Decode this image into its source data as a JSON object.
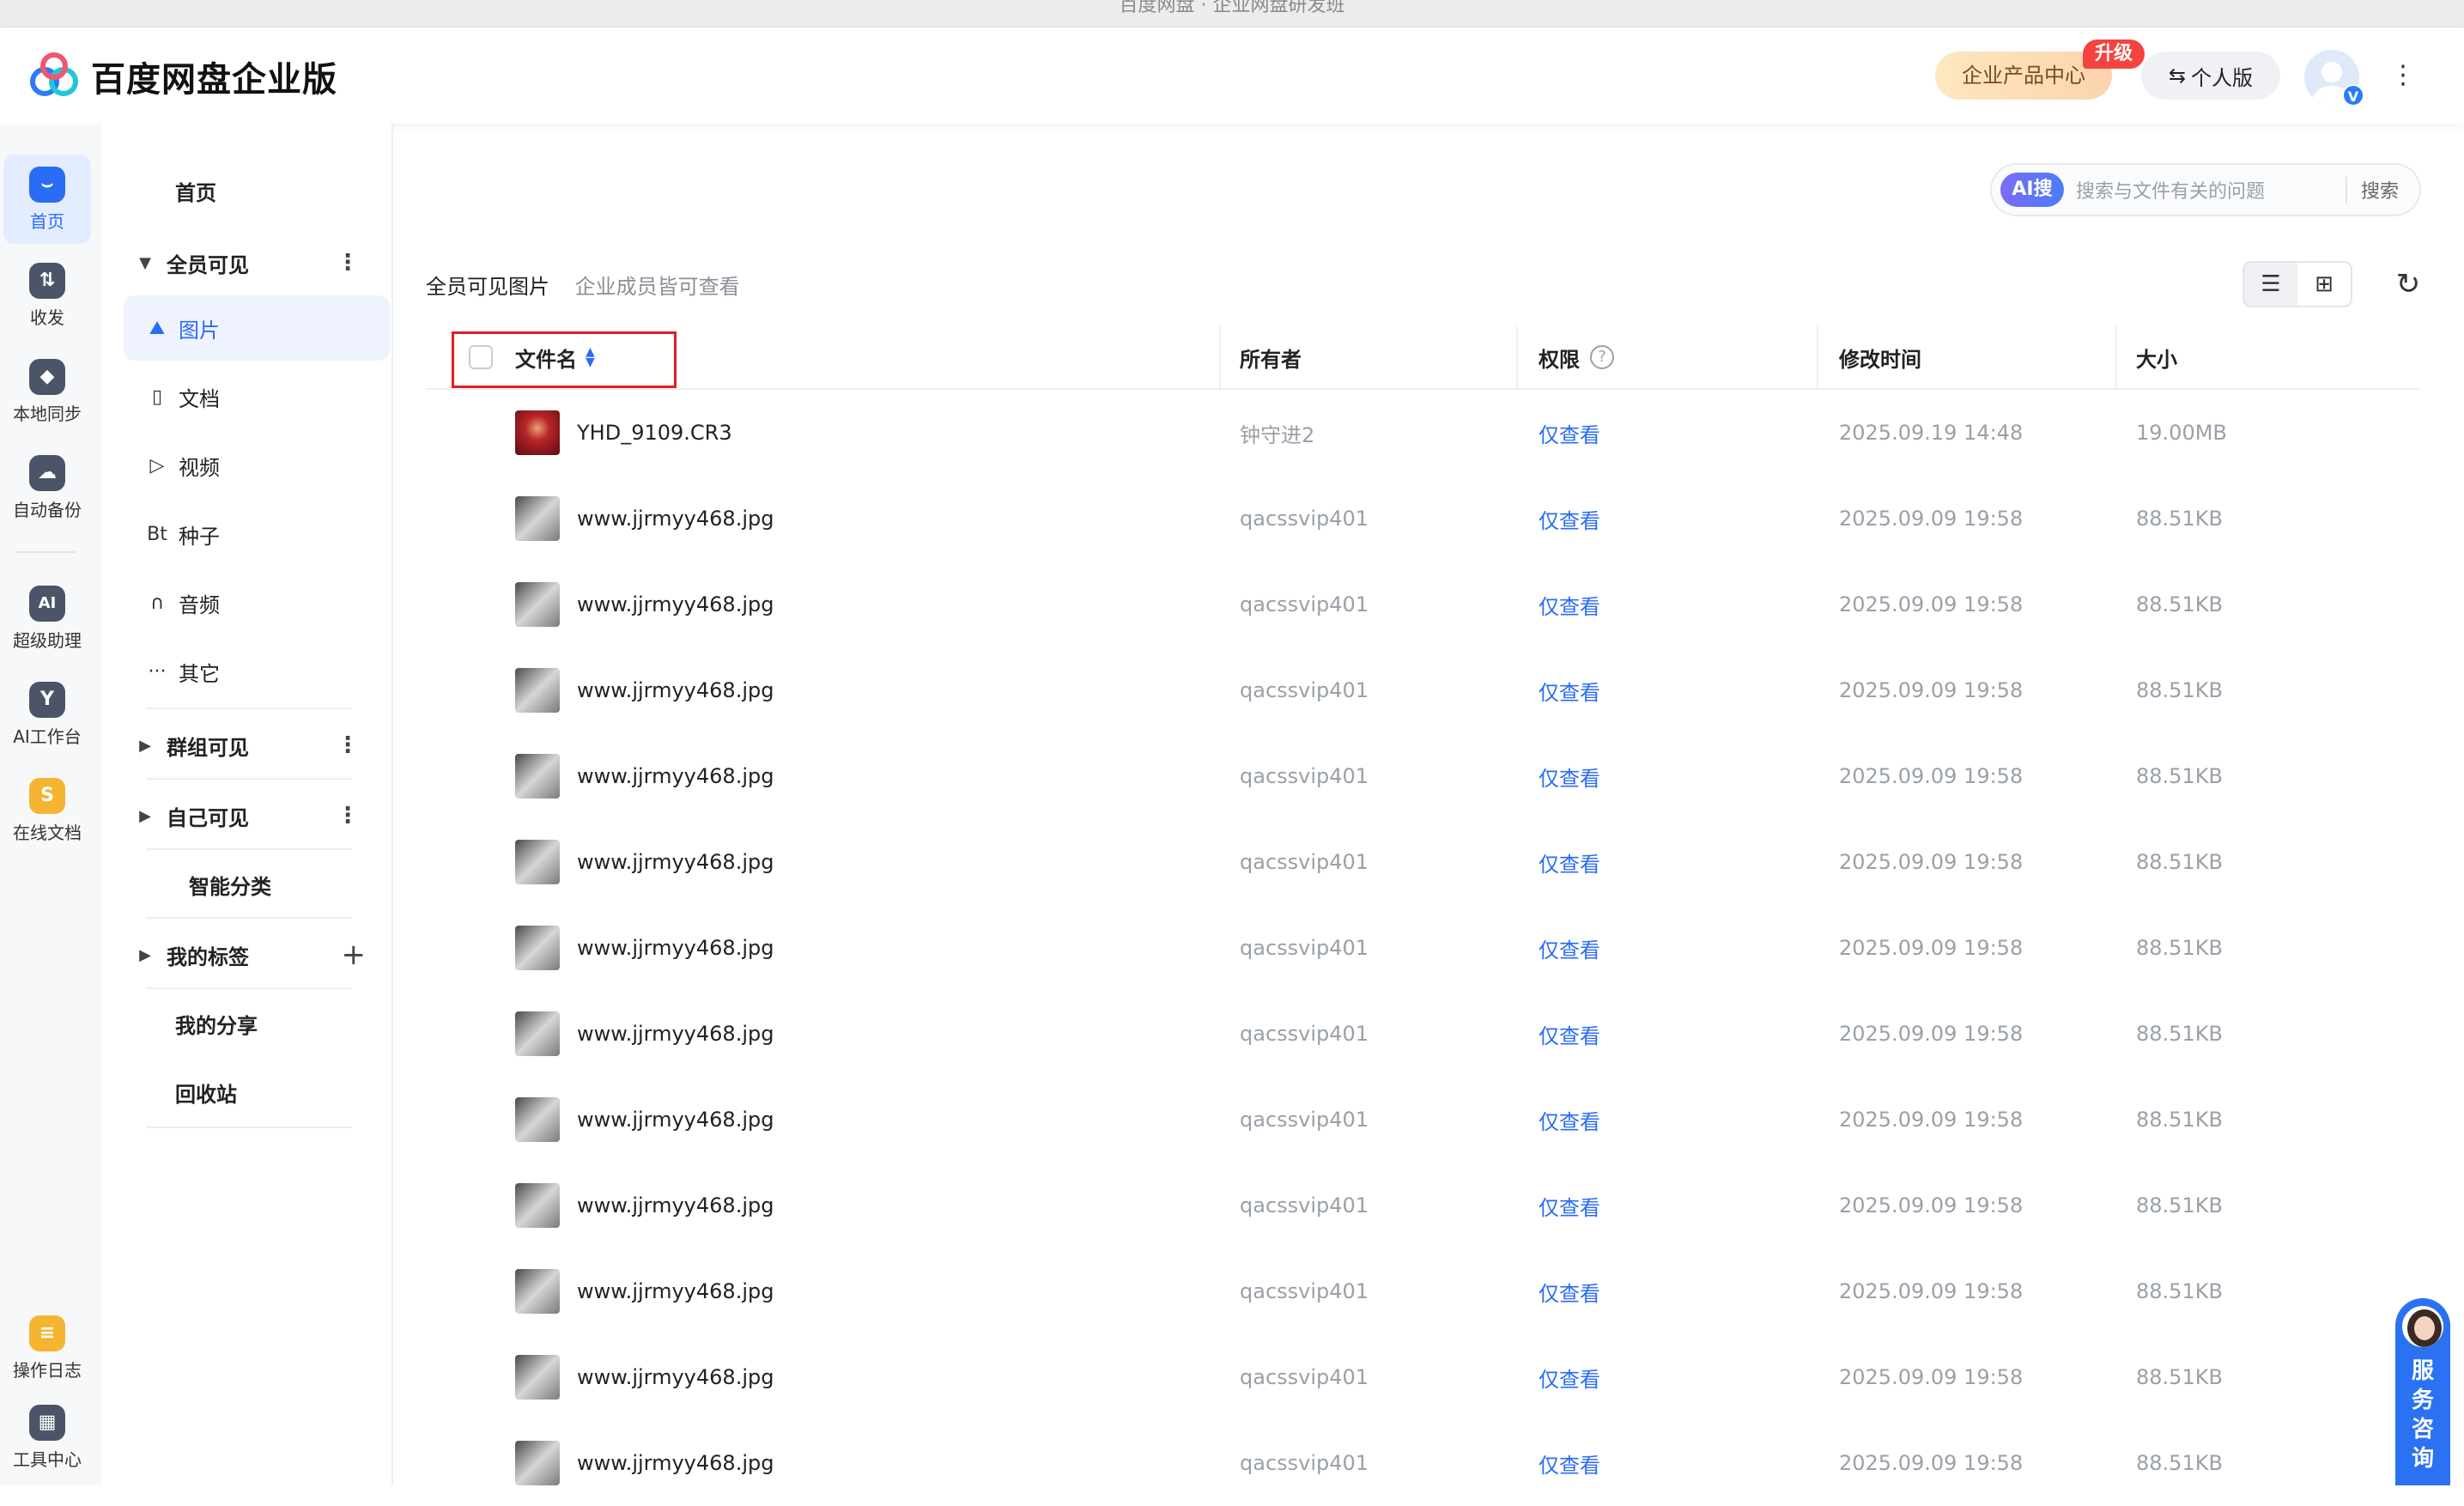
{
  "window": {
    "title": "百度网盘 · 企业网盘研发班"
  },
  "header": {
    "app_name": "百度网盘企业版",
    "product_center": "企业产品中心",
    "upgrade_badge": "升级",
    "personal_edition": "个人版",
    "avatar_badge": "V"
  },
  "rail": {
    "items": [
      {
        "label": "首页",
        "icon": "home-icon",
        "glyph": "⌣",
        "color": "#2a6cf6"
      },
      {
        "label": "收发",
        "icon": "transfer-icon",
        "glyph": "⇅",
        "color": "#4b5567"
      },
      {
        "label": "本地同步",
        "icon": "sync-icon",
        "glyph": "◆",
        "color": "#4b5567"
      },
      {
        "label": "自动备份",
        "icon": "cloud-backup-icon",
        "glyph": "☁",
        "color": "#4b5567"
      },
      {
        "label": "超级助理",
        "icon": "ai-assistant-icon",
        "glyph": "AI",
        "color": "#4b5567"
      },
      {
        "label": "AI工作台",
        "icon": "ai-workbench-icon",
        "glyph": "Y",
        "color": "#4b5567"
      },
      {
        "label": "在线文档",
        "icon": "online-doc-icon",
        "glyph": "S",
        "color": "#f5b531"
      },
      {
        "label": "操作日志",
        "icon": "operation-log-icon",
        "glyph": "≡",
        "color": "#f5b531"
      },
      {
        "label": "工具中心",
        "icon": "tool-center-icon",
        "glyph": "▦",
        "color": "#4b5567"
      }
    ]
  },
  "nav": {
    "home": "首页",
    "all_visible": "全员可见",
    "sub": [
      {
        "label": "图片",
        "icon": "image-icon",
        "glyph": "⛰"
      },
      {
        "label": "文档",
        "icon": "document-icon",
        "glyph": "▯"
      },
      {
        "label": "视频",
        "icon": "video-icon",
        "glyph": "▷"
      },
      {
        "label": "种子",
        "icon": "torrent-icon",
        "glyph": "Bt"
      },
      {
        "label": "音频",
        "icon": "audio-icon",
        "glyph": "∩"
      },
      {
        "label": "其它",
        "icon": "other-icon",
        "glyph": "···"
      }
    ],
    "group_visible": "群组可见",
    "self_visible": "自己可见",
    "smart_category": "智能分类",
    "my_tags": "我的标签",
    "my_share": "我的分享",
    "recycle_bin": "回收站"
  },
  "search": {
    "tag": "AI搜",
    "placeholder": "搜索与文件有关的问题",
    "button": "搜索"
  },
  "breadcrumb": {
    "title": "全员可见图片",
    "subtitle": "企业成员皆可查看"
  },
  "table": {
    "headers": {
      "name": "文件名",
      "owner": "所有者",
      "permission": "权限",
      "modified": "修改时间",
      "size": "大小"
    },
    "help_glyph": "?",
    "rows": [
      {
        "name": "YHD_9109.CR3",
        "owner": "钟守进2",
        "permission": "仅查看",
        "modified": "2025.09.19 14:48",
        "size": "19.00MB",
        "thumb": "red"
      },
      {
        "name": "www.jjrmyy468.jpg",
        "owner": "qacssvip401",
        "permission": "仅查看",
        "modified": "2025.09.09 19:58",
        "size": "88.51KB",
        "thumb": "gray"
      },
      {
        "name": "www.jjrmyy468.jpg",
        "owner": "qacssvip401",
        "permission": "仅查看",
        "modified": "2025.09.09 19:58",
        "size": "88.51KB",
        "thumb": "gray"
      },
      {
        "name": "www.jjrmyy468.jpg",
        "owner": "qacssvip401",
        "permission": "仅查看",
        "modified": "2025.09.09 19:58",
        "size": "88.51KB",
        "thumb": "gray"
      },
      {
        "name": "www.jjrmyy468.jpg",
        "owner": "qacssvip401",
        "permission": "仅查看",
        "modified": "2025.09.09 19:58",
        "size": "88.51KB",
        "thumb": "gray"
      },
      {
        "name": "www.jjrmyy468.jpg",
        "owner": "qacssvip401",
        "permission": "仅查看",
        "modified": "2025.09.09 19:58",
        "size": "88.51KB",
        "thumb": "gray"
      },
      {
        "name": "www.jjrmyy468.jpg",
        "owner": "qacssvip401",
        "permission": "仅查看",
        "modified": "2025.09.09 19:58",
        "size": "88.51KB",
        "thumb": "gray"
      },
      {
        "name": "www.jjrmyy468.jpg",
        "owner": "qacssvip401",
        "permission": "仅查看",
        "modified": "2025.09.09 19:58",
        "size": "88.51KB",
        "thumb": "gray"
      },
      {
        "name": "www.jjrmyy468.jpg",
        "owner": "qacssvip401",
        "permission": "仅查看",
        "modified": "2025.09.09 19:58",
        "size": "88.51KB",
        "thumb": "gray"
      },
      {
        "name": "www.jjrmyy468.jpg",
        "owner": "qacssvip401",
        "permission": "仅查看",
        "modified": "2025.09.09 19:58",
        "size": "88.51KB",
        "thumb": "gray"
      },
      {
        "name": "www.jjrmyy468.jpg",
        "owner": "qacssvip401",
        "permission": "仅查看",
        "modified": "2025.09.09 19:58",
        "size": "88.51KB",
        "thumb": "gray"
      },
      {
        "name": "www.jjrmyy468.jpg",
        "owner": "qacssvip401",
        "permission": "仅查看",
        "modified": "2025.09.09 19:58",
        "size": "88.51KB",
        "thumb": "gray"
      },
      {
        "name": "www.jjrmyy468.jpg",
        "owner": "qacssvip401",
        "permission": "仅查看",
        "modified": "2025.09.09 19:58",
        "size": "88.51KB",
        "thumb": "gray"
      }
    ]
  },
  "service": {
    "label": "服务咨询"
  },
  "colors": {
    "accent": "#2a6cf6",
    "highlight_box": "#e02020",
    "upgrade": "#f5433f"
  }
}
